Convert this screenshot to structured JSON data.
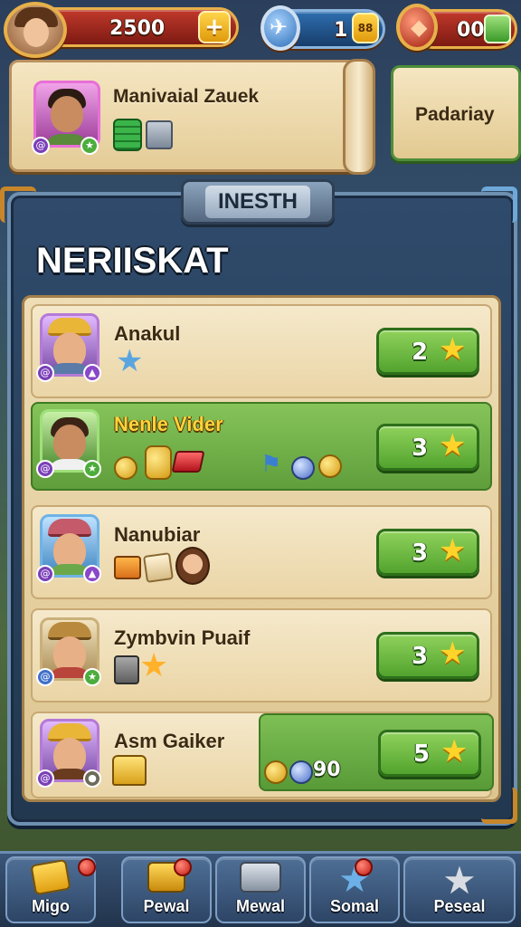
{
  "topbar": {
    "coins": "2500",
    "add_symbol": "+",
    "level": "1",
    "level_icon_text": "88",
    "gems": "00"
  },
  "header": {
    "player_name": "Manivaial Zauek",
    "side_label": "Padariay"
  },
  "panel": {
    "tab_label": "INESTH",
    "title": "NERIISKAT"
  },
  "rows": [
    {
      "name": "Anakul",
      "score": "2"
    },
    {
      "name": "Nenle Vider",
      "score": "3"
    },
    {
      "name": "Nanubiar",
      "score": "3"
    },
    {
      "name": "Zymbvin Puaif",
      "score": "3"
    },
    {
      "name": "Asm Gaiker",
      "score": "5"
    }
  ],
  "reward": {
    "value": "90"
  },
  "nav": [
    {
      "label": "Migo",
      "icon": "gift-box-icon"
    },
    {
      "label": "Pewal",
      "icon": "treasure-icon"
    },
    {
      "label": "Mewal",
      "icon": "robot-icon"
    },
    {
      "label": "Somal",
      "icon": "star-icon"
    },
    {
      "label": "Peseal",
      "icon": "silver-star-icon"
    }
  ],
  "colors": {
    "accent_gold": "#e7b04a",
    "active_green": "#5f9e3b",
    "panel_blue": "#2f4a6b"
  }
}
